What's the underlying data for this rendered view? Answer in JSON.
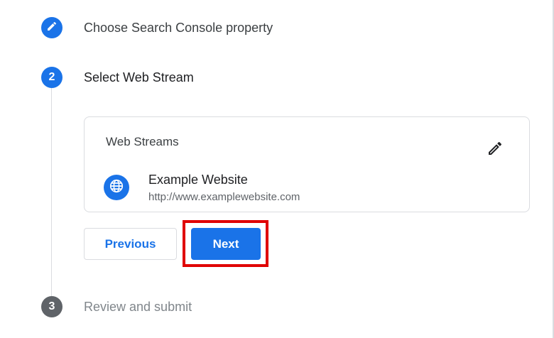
{
  "stepper": {
    "steps": [
      {
        "number": "",
        "title": "Choose Search Console property",
        "icon": "pencil-icon",
        "state": "completed"
      },
      {
        "number": "2",
        "title": "Select Web Stream",
        "state": "active"
      },
      {
        "number": "3",
        "title": "Review and submit",
        "state": "inactive"
      }
    ]
  },
  "web_streams": {
    "heading": "Web Streams",
    "edit_icon": "pencil-icon",
    "stream": {
      "icon": "globe-icon",
      "name": "Example Website",
      "url": "http://www.examplewebsite.com"
    }
  },
  "actions": {
    "previous_label": "Previous",
    "next_label": "Next"
  },
  "colors": {
    "accent": "#1a73e8",
    "highlight": "#e00000",
    "inactive_step": "#5f6368"
  }
}
